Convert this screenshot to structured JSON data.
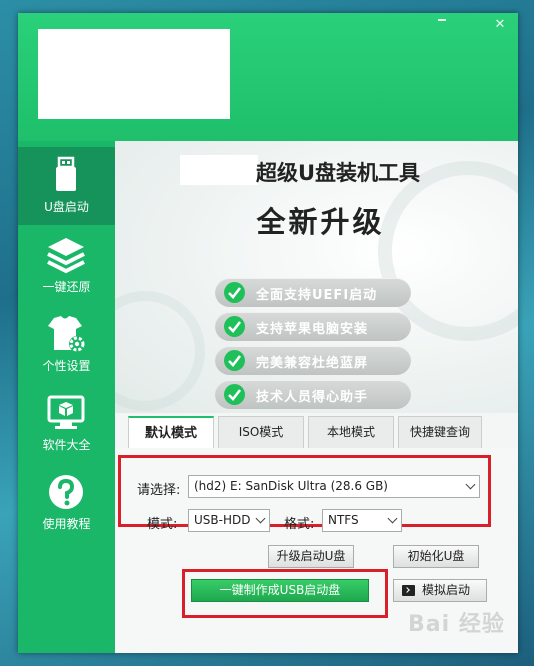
{
  "app": {
    "title": "超级U盘装机工具",
    "window_controls": {
      "minimize": "",
      "close": "✕"
    }
  },
  "sidebar": {
    "items": [
      {
        "label": "U盘启动",
        "icon": "usb-drive-icon",
        "active": true
      },
      {
        "label": "一键还原",
        "icon": "layers-icon",
        "active": false
      },
      {
        "label": "个性设置",
        "icon": "tshirt-gear-icon",
        "active": false
      },
      {
        "label": "软件大全",
        "icon": "monitor-box-icon",
        "active": false
      },
      {
        "label": "使用教程",
        "icon": "question-icon",
        "active": false
      }
    ]
  },
  "banner": {
    "title": "超级U盘装机工具",
    "subtitle": "全新升级",
    "features": [
      "全面支持UEFI启动",
      "支持苹果电脑安装",
      "完美兼容杜绝蓝屏",
      "技术人员得心助手"
    ]
  },
  "tabs": [
    {
      "label": "默认模式",
      "active": true
    },
    {
      "label": "ISO模式",
      "active": false
    },
    {
      "label": "本地模式",
      "active": false
    },
    {
      "label": "快捷键查询",
      "active": false
    }
  ],
  "form": {
    "device_label": "请选择:",
    "device_value": "(hd2) E: SanDisk Ultra (28.6 GB)",
    "mode_label": "模式:",
    "mode_value": "USB-HDD",
    "format_label": "格式:",
    "format_value": "NTFS"
  },
  "buttons": {
    "upgrade": "升级启动U盘",
    "init": "初始化U盘",
    "make": "一键制作成USB启动盘",
    "simulate": "模拟启动"
  },
  "watermark": "Bai 经验",
  "colors": {
    "brand_green": "#1fbf6b",
    "sidebar_green": "#1bb768",
    "highlight_red": "#d9202a"
  }
}
